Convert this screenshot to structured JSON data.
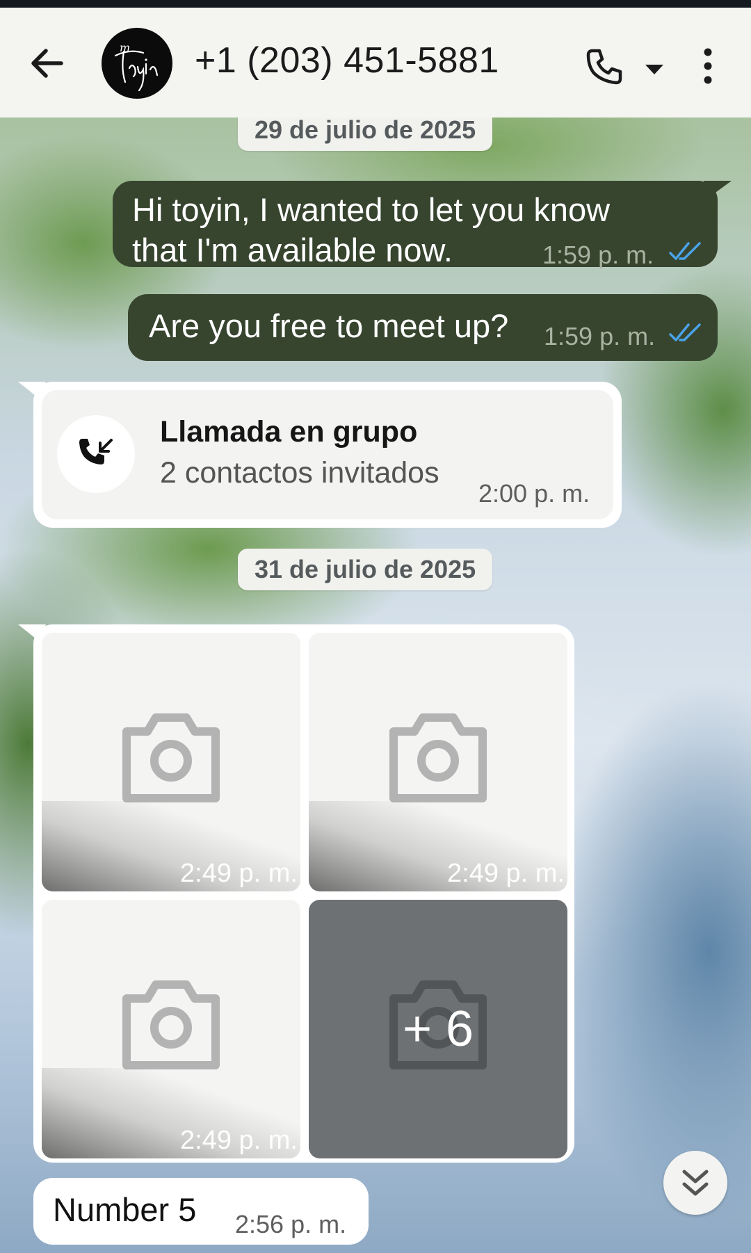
{
  "header": {
    "title": "+1 (203) 451-5881",
    "avatar_text": "m toyin"
  },
  "chat": {
    "dates": [
      "29 de julio de 2025",
      "31 de julio de 2025"
    ],
    "messages": [
      {
        "text_line1": "Hi toyin, I wanted to let you know",
        "text_line2": "that I'm available now.",
        "time": "1:59 p. m."
      },
      {
        "text": "Are you free to meet up?",
        "time": "1:59 p. m."
      }
    ],
    "call": {
      "title": "Llamada en grupo",
      "subtitle": "2 contactos invitados",
      "time": "2:00 p. m."
    },
    "photos": {
      "times": [
        "2:49 p. m.",
        "2:49 p. m.",
        "2:49 p. m."
      ],
      "more_count": "+ 6"
    },
    "last": {
      "text": "Number 5",
      "time": "2:56 p. m."
    }
  },
  "colors": {
    "outgoing_bubble": "#37452f",
    "read_ticks": "#4aa3e8",
    "appbar": "#f4f4f1"
  }
}
